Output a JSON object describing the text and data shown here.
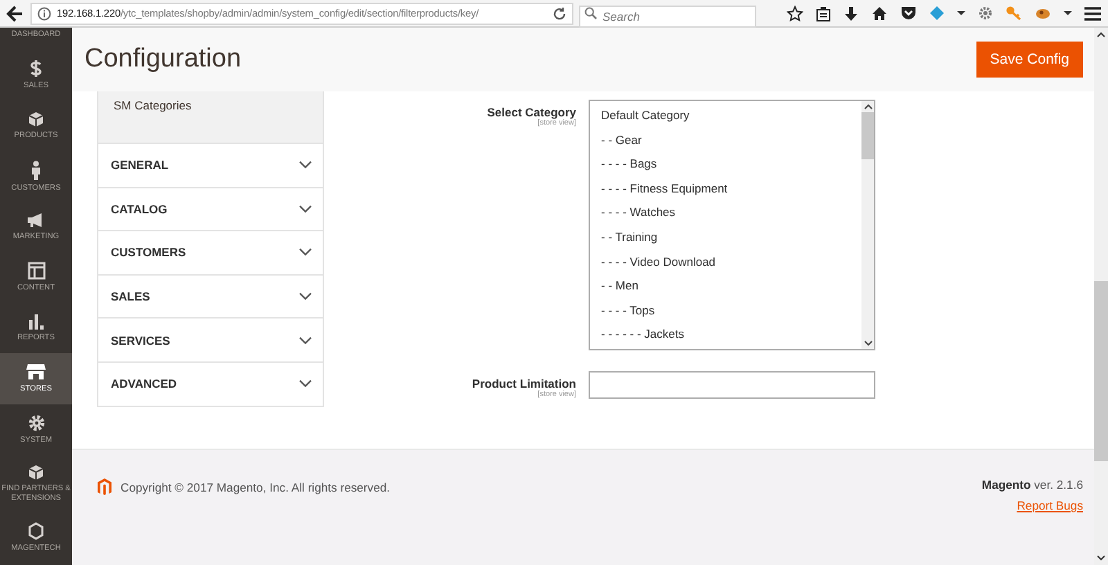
{
  "browser": {
    "url_host": "192.168.1.220",
    "url_path": "/ytc_templates/shopby/admin/admin/system_config/edit/section/filterproducts/key/",
    "search_placeholder": "Search"
  },
  "nav": [
    {
      "label": "DASHBOARD",
      "selected": false
    },
    {
      "label": "SALES",
      "selected": false
    },
    {
      "label": "PRODUCTS",
      "selected": false
    },
    {
      "label": "CUSTOMERS",
      "selected": false
    },
    {
      "label": "MARKETING",
      "selected": false
    },
    {
      "label": "CONTENT",
      "selected": false
    },
    {
      "label": "REPORTS",
      "selected": false
    },
    {
      "label": "STORES",
      "selected": true
    },
    {
      "label": "SYSTEM",
      "selected": false
    },
    {
      "label": "FIND PARTNERS & EXTENSIONS",
      "selected": false
    },
    {
      "label": "MAGENTECH",
      "selected": false
    }
  ],
  "page_title": "Configuration",
  "save_button": "Save Config",
  "config_tabs": [
    {
      "kind": "item",
      "label": "SM Categories",
      "selected": true
    },
    {
      "kind": "section",
      "label": "GENERAL",
      "expanded": false
    },
    {
      "kind": "section",
      "label": "CATALOG",
      "expanded": false
    },
    {
      "kind": "section",
      "label": "CUSTOMERS",
      "expanded": false
    },
    {
      "kind": "section",
      "label": "SALES",
      "expanded": false
    },
    {
      "kind": "section",
      "label": "SERVICES",
      "expanded": false
    },
    {
      "kind": "section",
      "label": "ADVANCED",
      "expanded": false
    }
  ],
  "fields": [
    {
      "kind": "multiselect",
      "label": "Select Category",
      "scope": "[store view]",
      "options": [
        "Default Category",
        "- - Gear",
        "- - - - Bags",
        "- - - - Fitness Equipment",
        "- - - - Watches",
        "- - Training",
        "- - - - Video Download",
        "- - Men",
        "- - - - Tops",
        "- - - - - - Jackets"
      ]
    },
    {
      "kind": "text",
      "label": "Product Limitation",
      "scope": "[store view]"
    }
  ],
  "footer": {
    "copyright": "Copyright © 2017 Magento, Inc. All rights reserved.",
    "version": "**Magento** ver. 2.1.6",
    "report_link": "Report Bugs"
  }
}
